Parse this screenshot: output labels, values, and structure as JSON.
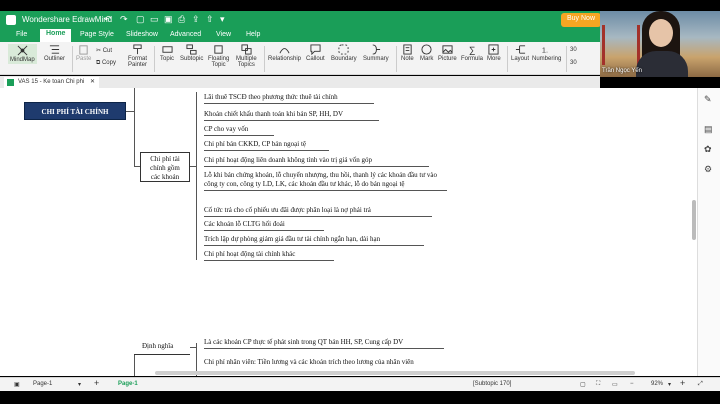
{
  "app": {
    "title": "Wondershare EdrawMind",
    "buy_now": "Buy Now"
  },
  "menu": {
    "tabs": [
      "File",
      "Home",
      "Page Style",
      "Slideshow",
      "Advanced",
      "View",
      "Help"
    ]
  },
  "ribbon": {
    "mindmap": "MindMap",
    "outliner": "Outliner",
    "paste": "Paste",
    "cut": "Cut",
    "copy": "Copy",
    "format_painter_1": "Format",
    "format_painter_2": "Painter",
    "topic": "Topic",
    "subtopic": "Subtopic",
    "floating_1": "Floating",
    "floating_2": "Topic",
    "multiple_1": "Multiple",
    "multiple_2": "Topics",
    "relationship": "Relationship",
    "callout": "Callout",
    "boundary": "Boundary",
    "summary": "Summary",
    "note": "Note",
    "mark": "Mark",
    "picture": "Picture",
    "formula": "Formula",
    "more": "More",
    "layout": "Layout",
    "numbering": "Numbering",
    "size_1": "30",
    "size_2": "30"
  },
  "document": {
    "tab_title": "VAS 15 - Ke toan Chi phi"
  },
  "mindmap": {
    "root": "CHI PHÍ TÀI CHÍNH",
    "branch": "Chi phí tài chính gồm các khoản",
    "leaves": [
      "Lãi thuê TSCĐ theo phương thức thuê tài chính",
      "Khoản chiết khấu thanh toán khi bán SP, HH, DV",
      "CP cho vay vốn",
      "Chi phí bán CKKD, CP bán ngoại tệ",
      "Chi phí hoạt động liên doanh không tính vào trị giá vốn góp",
      "Lỗ khi bán chứng khoán, lỗ chuyển nhượng, thu hồi, thanh lý các khoản đầu tư vào công ty con, công ty LD, LK, các khoản đầu tư khác, lỗ do bán ngoại tệ",
      "Cổ tức trả cho cổ phiếu ưu đãi được phân loại là nợ phải trả",
      "Các khoản lỗ CLTG hối đoái",
      "Trích lập dự phòng giảm giá đầu tư tài chính ngắn hạn, dài hạn",
      "Chi phí hoạt động tài chính khác"
    ],
    "definition_label": "Định nghĩa",
    "definition_text": "Là các khoản CP thực tế phát sinh trong QT bán HH, SP, Cung cấp DV",
    "staff_cost_text": "Chi phí nhân viên: Tiền lương và các khoản trích theo lương của nhân viên"
  },
  "status": {
    "page_select": "Page-1",
    "page_tab": "Page-1",
    "subtopic_info": "[Subtopic 170]",
    "zoom": "92%"
  },
  "webcam": {
    "name": "Trần Ngọc Yến"
  },
  "colors": {
    "brand_green": "#1a9e58",
    "root_fill": "#1f3b6e",
    "buy_now": "#f6a623"
  }
}
